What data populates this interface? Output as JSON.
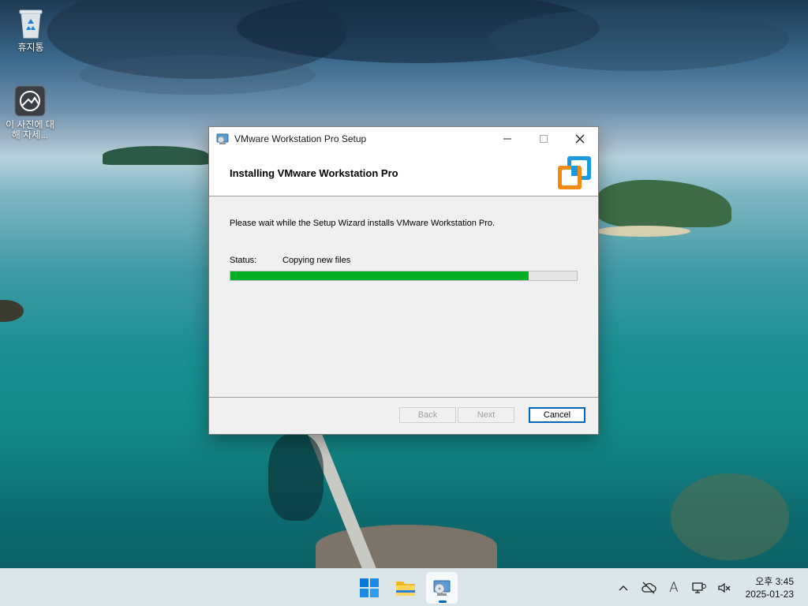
{
  "desktop": {
    "icons": [
      {
        "label": "휴지통",
        "icon": "recycle-bin-icon"
      },
      {
        "label": "이 사진에 대해 자세...",
        "icon": "photo-info-icon"
      }
    ]
  },
  "window": {
    "title": "VMware Workstation Pro Setup",
    "heading": "Installing VMware Workstation Pro",
    "description": "Please wait while the Setup Wizard installs VMware Workstation Pro.",
    "status_label": "Status:",
    "status_value": "Copying new files",
    "progress_percent": 86,
    "progress_color": "#06b025",
    "buttons": {
      "back": "Back",
      "next": "Next",
      "cancel": "Cancel"
    },
    "controls": [
      "minimize-icon",
      "maximize-icon",
      "close-icon"
    ]
  },
  "taskbar": {
    "apps": [
      {
        "name": "start-button",
        "icon": "windows-logo-icon"
      },
      {
        "name": "file-explorer",
        "icon": "folder-icon"
      },
      {
        "name": "vmware-setup",
        "icon": "installer-icon",
        "active": true
      }
    ],
    "tray_icons": [
      "chevron-up-icon",
      "cloud-offline-icon",
      "ime-icon",
      "display-icon",
      "speaker-muted-icon"
    ],
    "ime_label": "A",
    "clock_time": "오후 3:45",
    "clock_date": "2025-01-23"
  }
}
